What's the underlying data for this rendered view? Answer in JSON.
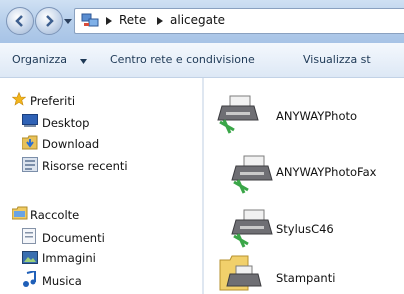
{
  "address": {
    "segments": [
      "Rete",
      "alicegate"
    ]
  },
  "toolbar": {
    "organize_label": "Organizza",
    "network_center_label": "Centro rete e condivisione",
    "view_label": "Visualizza st"
  },
  "sidebar": {
    "favorites": {
      "label": "Preferiti",
      "items": [
        "Desktop",
        "Download",
        "Risorse recenti"
      ]
    },
    "libraries": {
      "label": "Raccolte",
      "items": [
        "Documenti",
        "Immagini",
        "Musica"
      ]
    }
  },
  "files": [
    {
      "name": "ANYWAYPhoto",
      "icon": "network-printer-icon"
    },
    {
      "name": "ANYWAYPhotoFax",
      "icon": "network-printer-icon"
    },
    {
      "name": "StylusC46",
      "icon": "network-printer-icon"
    },
    {
      "name": "Stampanti",
      "icon": "printers-folder-icon"
    }
  ]
}
